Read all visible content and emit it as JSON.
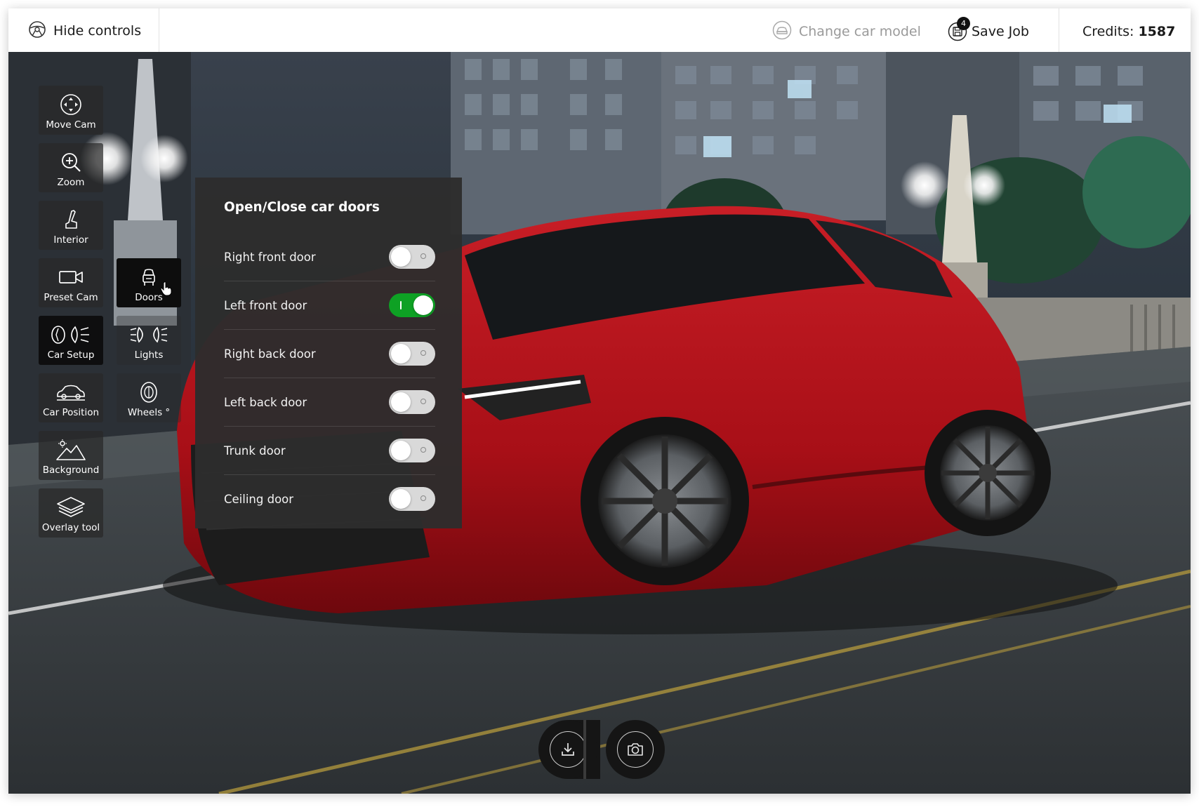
{
  "topbar": {
    "hide_controls": "Hide controls",
    "change_car_model": "Change car model",
    "save_job": "Save Job",
    "save_job_badge": "4",
    "credits_label": "Credits:",
    "credits_value": "1587"
  },
  "tools": {
    "move_cam": "Move Cam",
    "zoom": "Zoom",
    "interior": "Interior",
    "preset_cam": "Preset Cam",
    "doors": "Doors",
    "car_setup": "Car Setup",
    "lights": "Lights",
    "car_position": "Car Position",
    "wheels": "Wheels °",
    "background": "Background",
    "overlay_tool": "Overlay tool",
    "active": "Doors"
  },
  "doors_panel": {
    "title": "Open/Close car doors",
    "doors": [
      {
        "label": "Right front door",
        "open": false
      },
      {
        "label": "Left front door",
        "open": true
      },
      {
        "label": "Right back door",
        "open": false
      },
      {
        "label": "Left back door",
        "open": false
      },
      {
        "label": "Trunk door",
        "open": false
      },
      {
        "label": "Ceiling door",
        "open": false
      }
    ]
  },
  "icons": {
    "hide_controls": "steering-wheel-icon",
    "change_car_model": "car-front-icon",
    "save_job": "floppy-disk-icon",
    "download": "download-icon",
    "screenshot": "camera-icon"
  },
  "colors": {
    "toggle_on": "#0ea124",
    "toggle_off": "#d9d9d9",
    "panel_bg": "#2d2d2d",
    "car_body": "#b3121a"
  }
}
